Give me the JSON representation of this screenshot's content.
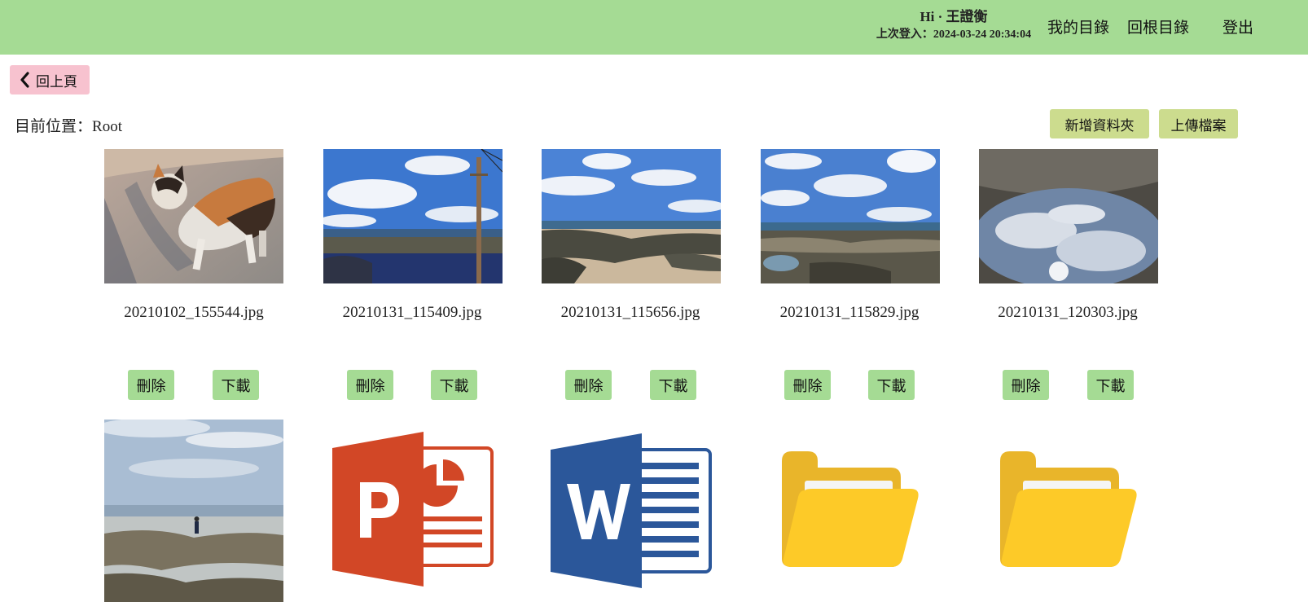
{
  "header": {
    "greeting": "Hi · 王證衡",
    "last_login": "上次登入：2024-03-24 20:34:04",
    "nav": [
      "我的目錄",
      "回根目錄",
      "登出"
    ]
  },
  "back_label": "回上頁",
  "location": {
    "label": "目前位置：",
    "value": "Root"
  },
  "actions": {
    "new_folder": "新增資料夾",
    "upload": "上傳檔案"
  },
  "buttons": {
    "delete": "刪除",
    "download": "下載"
  },
  "files": [
    {
      "name": "20210102_155544.jpg",
      "kind": "image",
      "subject": "calico-cat-photo"
    },
    {
      "name": "20210131_115409.jpg",
      "kind": "image",
      "subject": "coast-with-pole-photo"
    },
    {
      "name": "20210131_115656.jpg",
      "kind": "image",
      "subject": "rocky-beach-photo"
    },
    {
      "name": "20210131_115829.jpg",
      "kind": "image",
      "subject": "reef-photo"
    },
    {
      "name": "20210131_120303.jpg",
      "kind": "image",
      "subject": "tide-pool-reflection-photo"
    }
  ],
  "row2_items": [
    {
      "kind": "image",
      "icon": "coast-person-photo"
    },
    {
      "kind": "powerpoint",
      "icon": "powerpoint-icon"
    },
    {
      "kind": "word",
      "icon": "word-icon"
    },
    {
      "kind": "folder",
      "icon": "folder-icon"
    },
    {
      "kind": "folder",
      "icon": "folder-icon"
    }
  ],
  "colors": {
    "header_bg": "#a5db94",
    "back_btn_bg": "#f7c2cf",
    "action_btn_bg": "#ccdc8e",
    "item_btn_bg": "#a5db94",
    "powerpoint": "#d24726",
    "word": "#2b579a",
    "folder_front": "#fdca28",
    "folder_back": "#e9b52a"
  }
}
